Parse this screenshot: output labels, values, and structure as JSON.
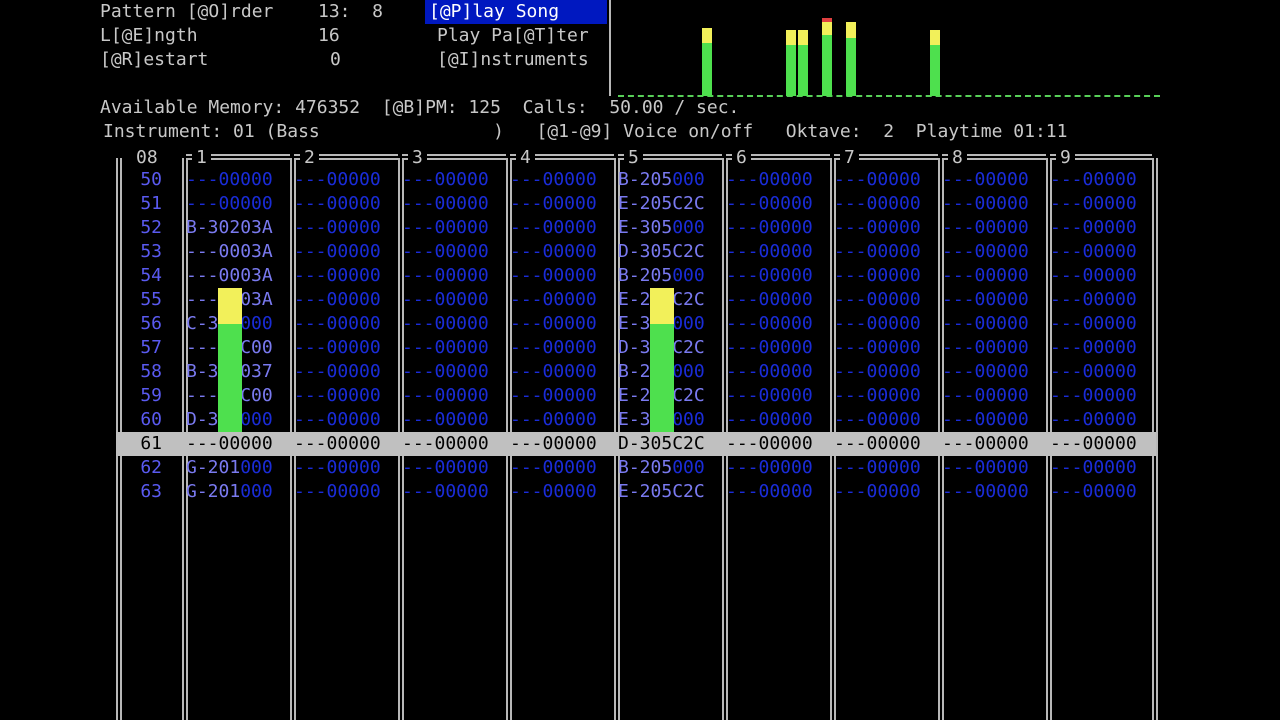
{
  "header": {
    "left": [
      {
        "label": "Pattern [@O]rder",
        "value": "13:  8"
      },
      {
        "label": "L[@E]ngth",
        "value": "16"
      },
      {
        "label": "[@R]estart",
        "value": "0"
      }
    ],
    "menu": [
      "[@P]lay Song",
      "Play Pa[@T]ter",
      "[@I]nstruments"
    ],
    "status1": "Available Memory: 476352  [@B]PM: 125  Calls:  50.00 / sec.",
    "status2": "Instrument: 01 (Bass                )   [@1-@9] Voice on/off   Oktave:  2  Playtime 01:11"
  },
  "spectrum_levels": [
    0.85,
    0.83,
    0.83,
    0.98,
    0.92,
    0.83
  ],
  "colors": {
    "green": "#4ee04e",
    "yellow": "#f2f05a",
    "red": "#e04040",
    "blue_empty": "#1a2cd8",
    "note": "#7a7af0",
    "highlight_bg": "#0018c0",
    "current_row": "#c0c0c0"
  },
  "pattern": {
    "pattern_num": "08",
    "channels": [
      "1",
      "2",
      "3",
      "4",
      "5",
      "6",
      "7",
      "8",
      "9"
    ],
    "current_row": "61",
    "rows": [
      {
        "n": "50",
        "cells": [
          "---00000",
          "---00000",
          "---00000",
          "---00000",
          "B-205000",
          "---00000",
          "---00000",
          "---00000",
          "---00000"
        ]
      },
      {
        "n": "51",
        "cells": [
          "---00000",
          "---00000",
          "---00000",
          "---00000",
          "E-205C2C",
          "---00000",
          "---00000",
          "---00000",
          "---00000"
        ]
      },
      {
        "n": "52",
        "cells": [
          "B-30203A",
          "---00000",
          "---00000",
          "---00000",
          "E-305000",
          "---00000",
          "---00000",
          "---00000",
          "---00000"
        ]
      },
      {
        "n": "53",
        "cells": [
          "---0003A",
          "---00000",
          "---00000",
          "---00000",
          "D-305C2C",
          "---00000",
          "---00000",
          "---00000",
          "---00000"
        ]
      },
      {
        "n": "54",
        "cells": [
          "---0003A",
          "---00000",
          "---00000",
          "---00000",
          "B-205000",
          "---00000",
          "---00000",
          "---00000",
          "---00000"
        ]
      },
      {
        "n": "55",
        "cells": [
          "---0003A",
          "---00000",
          "---00000",
          "---00000",
          "E-205C2C",
          "---00000",
          "---00000",
          "---00000",
          "---00000"
        ]
      },
      {
        "n": "56",
        "cells": [
          "C-302000",
          "---00000",
          "---00000",
          "---00000",
          "E-305000",
          "---00000",
          "---00000",
          "---00000",
          "---00000"
        ]
      },
      {
        "n": "57",
        "cells": [
          "---00C00",
          "---00000",
          "---00000",
          "---00000",
          "D-305C2C",
          "---00000",
          "---00000",
          "---00000",
          "---00000"
        ]
      },
      {
        "n": "58",
        "cells": [
          "B-302037",
          "---00000",
          "---00000",
          "---00000",
          "B-205000",
          "---00000",
          "---00000",
          "---00000",
          "---00000"
        ]
      },
      {
        "n": "59",
        "cells": [
          "---00C00",
          "---00000",
          "---00000",
          "---00000",
          "E-205C2C",
          "---00000",
          "---00000",
          "---00000",
          "---00000"
        ]
      },
      {
        "n": "60",
        "cells": [
          "D-302000",
          "---00000",
          "---00000",
          "---00000",
          "E-305000",
          "---00000",
          "---00000",
          "---00000",
          "---00000"
        ]
      },
      {
        "n": "61",
        "cells": [
          "---00000",
          "---00000",
          "---00000",
          "---00000",
          "D-305C2C",
          "---00000",
          "---00000",
          "---00000",
          "---00000"
        ]
      },
      {
        "n": "62",
        "cells": [
          "G-201000",
          "---00000",
          "---00000",
          "---00000",
          "B-205000",
          "---00000",
          "---00000",
          "---00000",
          "---00000"
        ]
      },
      {
        "n": "63",
        "cells": [
          "G-201000",
          "---00000",
          "---00000",
          "---00000",
          "E-205C2C",
          "---00000",
          "---00000",
          "---00000",
          "---00000"
        ]
      }
    ]
  },
  "channel_vu_levels": {
    "1": 0.75,
    "5": 0.75
  }
}
